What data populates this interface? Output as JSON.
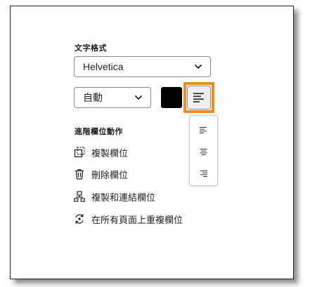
{
  "text_format": {
    "label": "文字格式",
    "font": "Helvetica",
    "size": "自動",
    "color": "#000000",
    "align_options": [
      "align-left-icon",
      "align-center-icon",
      "align-right-icon"
    ]
  },
  "advanced": {
    "label": "進階欄位動作",
    "actions": [
      {
        "label": "複製欄位",
        "icon": "duplicate-field-icon"
      },
      {
        "label": "刪除欄位",
        "icon": "trash-icon"
      },
      {
        "label": "複製和連結欄位",
        "icon": "duplicate-link-icon"
      },
      {
        "label": "在所有頁面上重複欄位",
        "icon": "repeat-pages-icon"
      }
    ]
  },
  "colors": {
    "highlight": "#f08a24",
    "border": "#8a8a8a"
  }
}
